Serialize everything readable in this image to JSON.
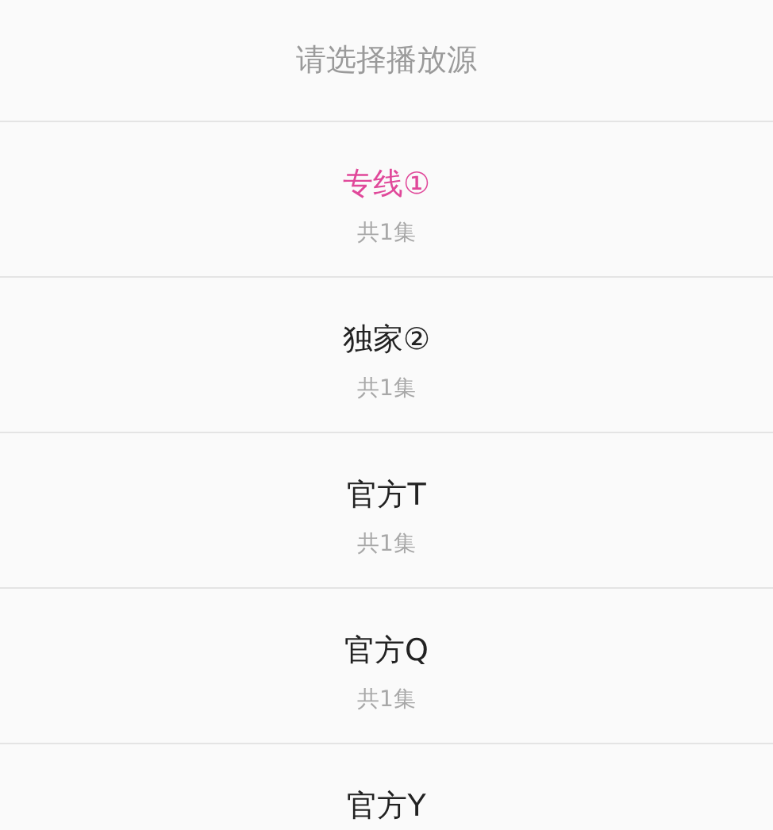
{
  "header": {
    "title": "请选择播放源"
  },
  "sources": [
    {
      "name": "专线①",
      "episodes": "共1集",
      "selected": true
    },
    {
      "name": "独家②",
      "episodes": "共1集",
      "selected": false
    },
    {
      "name": "官方T",
      "episodes": "共1集",
      "selected": false
    },
    {
      "name": "官方Q",
      "episodes": "共1集",
      "selected": false
    },
    {
      "name": "官方Y",
      "selected": false
    }
  ]
}
